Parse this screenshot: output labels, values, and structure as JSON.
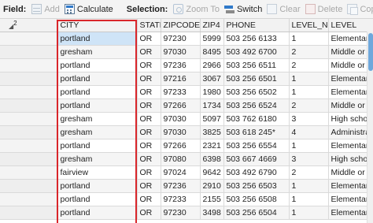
{
  "toolbar": {
    "field_label": "Field:",
    "add_label": "Add",
    "calculate_label": "Calculate",
    "selection_label": "Selection:",
    "zoom_label": "Zoom To",
    "switch_label": "Switch",
    "clear_label": "Clear",
    "delete_label": "Delete",
    "copy_label": "Copy"
  },
  "table": {
    "headers": {
      "city": "CITY",
      "state": "STATE",
      "zipcode": "ZIPCODE",
      "zip4": "ZIP4",
      "phone": "PHONE",
      "level_no": "LEVEL_NO",
      "level": "LEVEL"
    },
    "corner_marker": "2",
    "rows": [
      {
        "city": "portland",
        "state": "OR",
        "zipcode": "97230",
        "zip4": "5999",
        "phone": "503 256 6133",
        "level_no": "1",
        "level": "Elementary"
      },
      {
        "city": "gresham",
        "state": "OR",
        "zipcode": "97030",
        "zip4": "8495",
        "phone": "503 492 6700",
        "level_no": "2",
        "level": "Middle or ju"
      },
      {
        "city": "portland",
        "state": "OR",
        "zipcode": "97236",
        "zip4": "2966",
        "phone": "503 256 6511",
        "level_no": "2",
        "level": "Middle or ju"
      },
      {
        "city": "portland",
        "state": "OR",
        "zipcode": "97216",
        "zip4": "3067",
        "phone": "503 256 6501",
        "level_no": "1",
        "level": "Elementary"
      },
      {
        "city": "portland",
        "state": "OR",
        "zipcode": "97233",
        "zip4": "1980",
        "phone": "503 256 6502",
        "level_no": "1",
        "level": "Elementary"
      },
      {
        "city": "portland",
        "state": "OR",
        "zipcode": "97266",
        "zip4": "1734",
        "phone": "503 256 6524",
        "level_no": "2",
        "level": "Middle or ju"
      },
      {
        "city": "gresham",
        "state": "OR",
        "zipcode": "97030",
        "zip4": "5097",
        "phone": "503 762 6180",
        "level_no": "3",
        "level": "High schoo"
      },
      {
        "city": "gresham",
        "state": "OR",
        "zipcode": "97030",
        "zip4": "3825",
        "phone": "503 618 245*",
        "level_no": "4",
        "level": "Administra"
      },
      {
        "city": "portland",
        "state": "OR",
        "zipcode": "97266",
        "zip4": "2321",
        "phone": "503 256 6554",
        "level_no": "1",
        "level": "Elementary"
      },
      {
        "city": "gresham",
        "state": "OR",
        "zipcode": "97080",
        "zip4": "6398",
        "phone": "503 667 4669",
        "level_no": "3",
        "level": "High schoo"
      },
      {
        "city": "fairview",
        "state": "OR",
        "zipcode": "97024",
        "zip4": "9642",
        "phone": "503 492 6790",
        "level_no": "2",
        "level": "Middle or ju"
      },
      {
        "city": "portland",
        "state": "OR",
        "zipcode": "97236",
        "zip4": "2910",
        "phone": "503 256 6503",
        "level_no": "1",
        "level": "Elementary"
      },
      {
        "city": "portland",
        "state": "OR",
        "zipcode": "97233",
        "zip4": "2155",
        "phone": "503 256 6508",
        "level_no": "1",
        "level": "Elementary"
      },
      {
        "city": "portland",
        "state": "OR",
        "zipcode": "97230",
        "zip4": "3498",
        "phone": "503 256 6504",
        "level_no": "1",
        "level": "Elementary"
      }
    ]
  },
  "colors": {
    "highlight_border": "#d9262b",
    "selected_cell": "#cfe4f7",
    "scroll_thumb": "#6fa8dc"
  }
}
